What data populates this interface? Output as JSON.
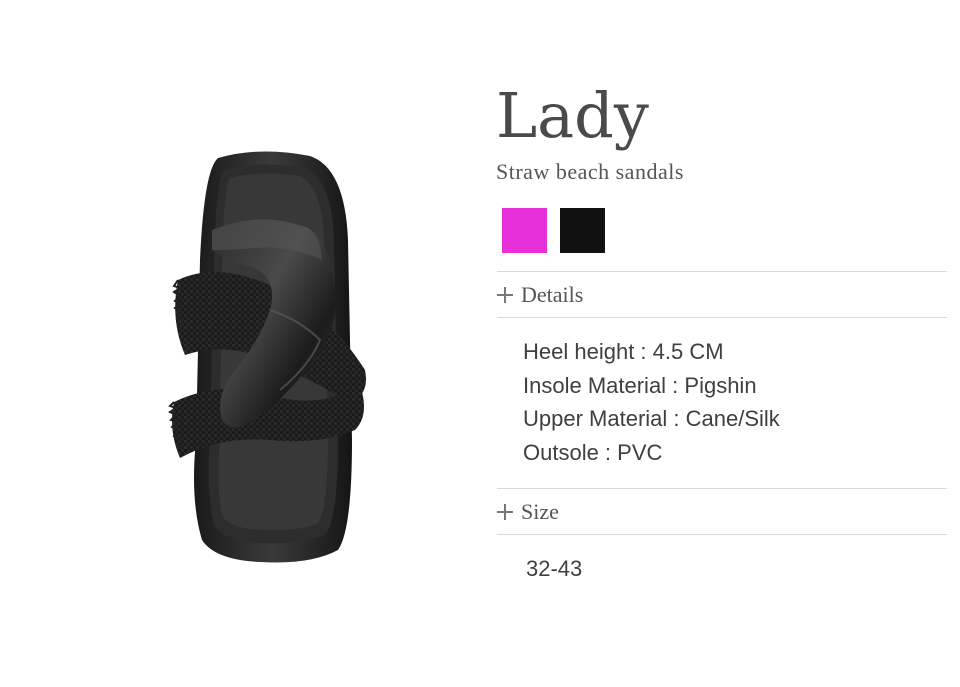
{
  "product": {
    "title": "Lady",
    "subtitle": "Straw beach sandals",
    "image_alt": "black sandal top view"
  },
  "colors": [
    {
      "name": "magenta",
      "hex": "#e730d9"
    },
    {
      "name": "black",
      "hex": "#111111"
    }
  ],
  "details": {
    "heading": "Details",
    "items": [
      "Heel height : 4.5 CM",
      "Insole Material : Pigshin",
      "Upper Material : Cane/Silk",
      "Outsole : PVC"
    ]
  },
  "size": {
    "heading": "Size",
    "value": "32-43"
  }
}
